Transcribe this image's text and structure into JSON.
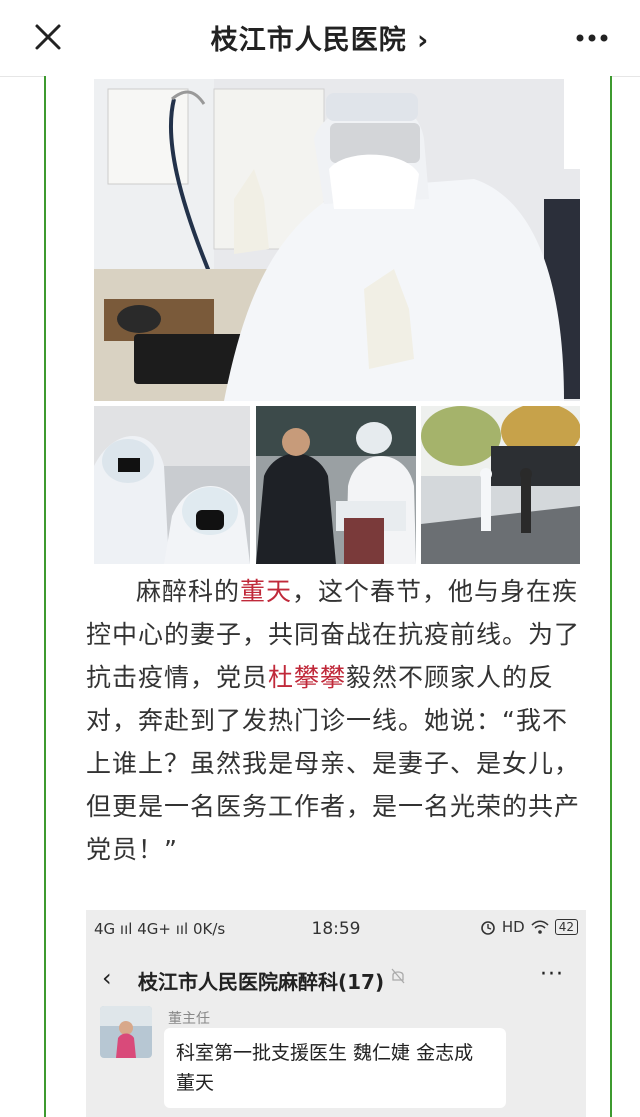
{
  "header": {
    "title": "枝江市人民医院 ›",
    "close_icon": "close-icon",
    "more_icon": "more-dots-icon"
  },
  "photos": [
    {
      "name": "main-photo-thumbs-up-doctor"
    },
    {
      "name": "photo-two-staff-face-shields"
    },
    {
      "name": "photo-patient-check-in"
    },
    {
      "name": "photo-outdoor-street-screening"
    }
  ],
  "article": {
    "p1_a": "麻醉科的",
    "name1": "董天",
    "p1_b": "，这个春节，他与身在疾控中心的妻子，共同奋战在抗疫前线。为了抗击疫情，党员",
    "name2": "杜攀攀",
    "p1_c": "毅然不顾家人的反对，奔赴到了发热门诊一线。她说：“我不上谁上？虽然我是母亲、是妻子、是女儿，但更是一名医务工作者，是一名光荣的共产党员！”"
  },
  "screenshot": {
    "status_left": "4G ııl 4G+ ııl 0K/s",
    "time": "18:59",
    "status_right_hd": "HD",
    "battery": "42",
    "back": "‹",
    "group_name": "枝江市人民医院麻醉科(17)",
    "more": "···",
    "sender": "董主任",
    "message": "科室第一批支援医生 魏仁婕  金志成  董天"
  },
  "colors": {
    "accent_green": "#3d9a2f",
    "highlight_red": "#c0293a"
  }
}
